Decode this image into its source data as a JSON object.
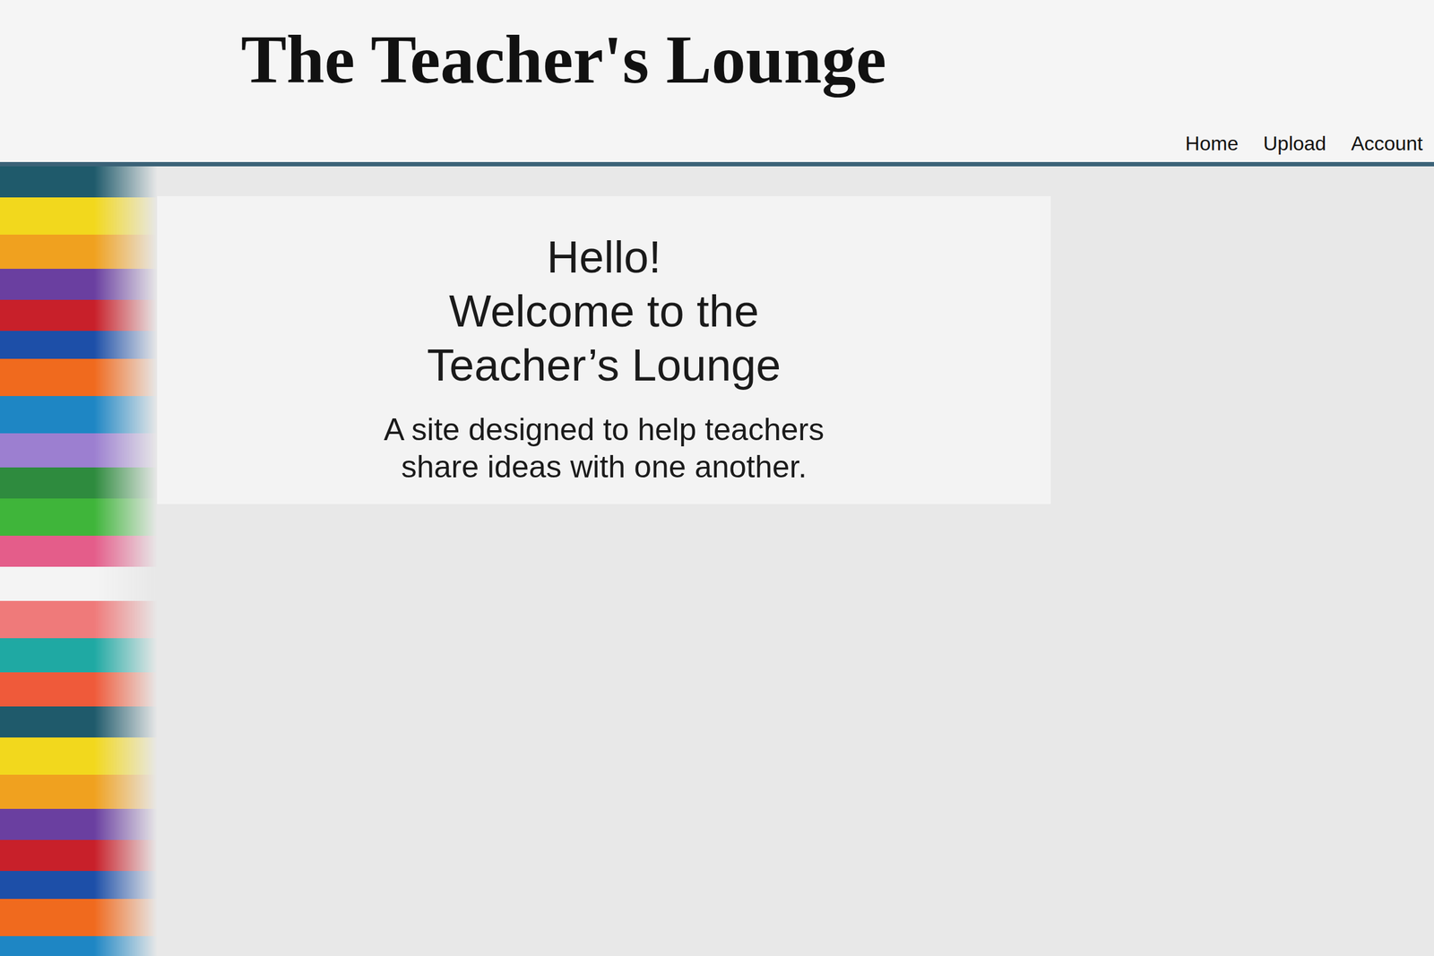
{
  "site": {
    "title": "The Teacher's Lounge"
  },
  "nav": [
    {
      "label": "Home"
    },
    {
      "label": "Upload"
    },
    {
      "label": "Account"
    }
  ],
  "welcome": {
    "heading": [
      "Hello!",
      "Welcome to the",
      "Teacher’s Lounge"
    ],
    "subtitle": [
      "A site designed to help teachers",
      "share ideas with one another."
    ]
  }
}
